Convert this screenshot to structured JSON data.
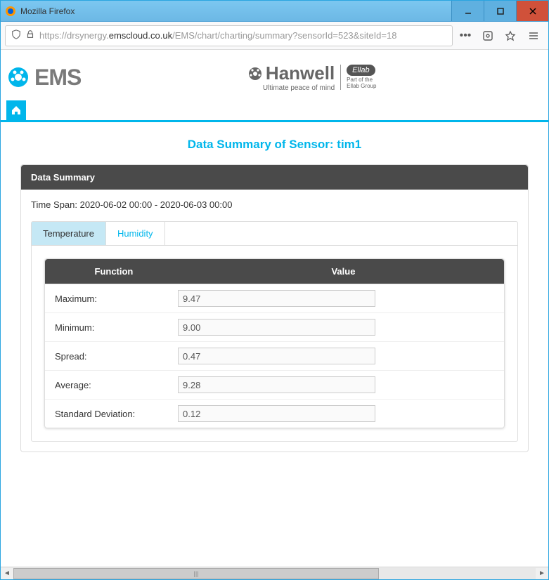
{
  "window": {
    "title": "Mozilla Firefox"
  },
  "browser": {
    "url_prefix": "https://drsynergy.",
    "url_domain": "emscloud.co.uk",
    "url_path": "/EMS/chart/charting/summary?sensorId=523&siteId=18"
  },
  "header": {
    "ems_label": "EMS",
    "hanwell_label": "Hanwell",
    "hanwell_tagline": "Ultimate peace of mind",
    "ellab_label": "Ellab",
    "ellab_sub1": "Part of the",
    "ellab_sub2": "Ellab Group"
  },
  "page": {
    "title": "Data Summary of Sensor: tim1",
    "panel_header": "Data Summary",
    "timespan_label": "Time Span: 2020-06-02 00:00 - 2020-06-03 00:00"
  },
  "tabs": {
    "temperature": "Temperature",
    "humidity": "Humidity"
  },
  "table": {
    "col_function": "Function",
    "col_value": "Value",
    "rows": [
      {
        "label": "Maximum:",
        "value": "9.47"
      },
      {
        "label": "Minimum:",
        "value": "9.00"
      },
      {
        "label": "Spread:",
        "value": "0.47"
      },
      {
        "label": "Average:",
        "value": "9.28"
      },
      {
        "label": "Standard Deviation:",
        "value": "0.12"
      }
    ]
  }
}
